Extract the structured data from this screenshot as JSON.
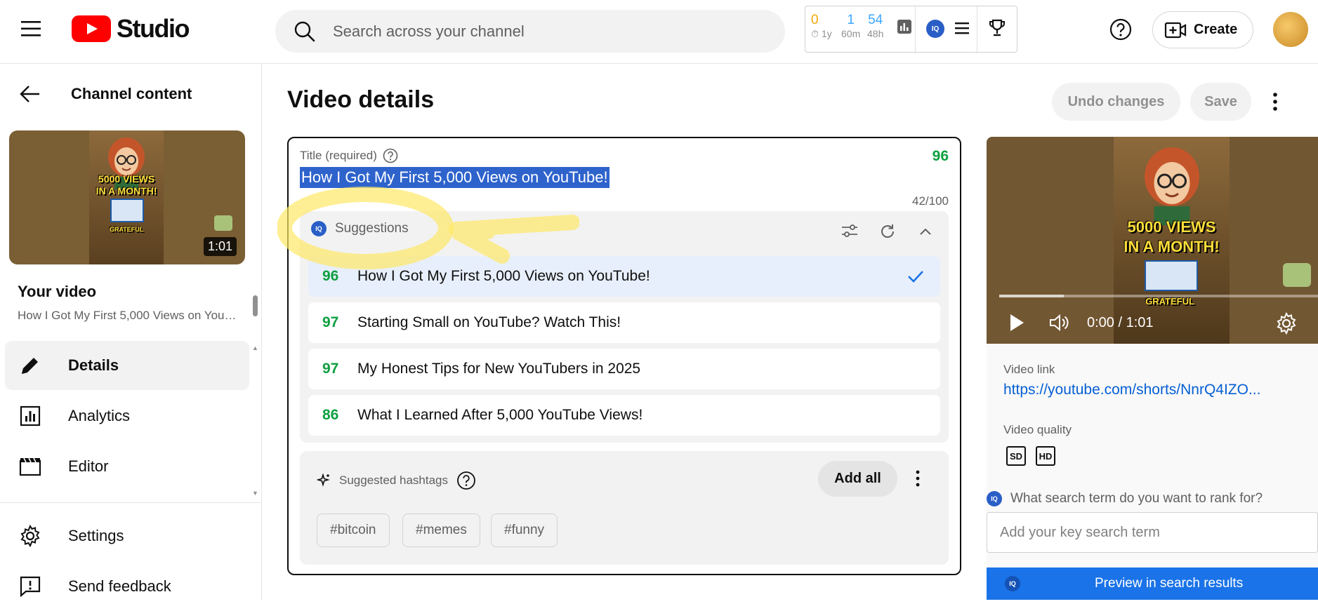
{
  "header": {
    "logo_text": "Studio",
    "search_placeholder": "Search across your channel",
    "vidiq_stats": [
      {
        "value": "0",
        "sub": "1y",
        "color": "#f6a609"
      },
      {
        "value": "1",
        "sub": "60m",
        "color": "#3ea6ff"
      },
      {
        "value": "54",
        "sub": "48h",
        "color": "#3ea6ff"
      }
    ],
    "vidiq_badge": "IQ",
    "create_label": "Create"
  },
  "sidebar": {
    "title": "Channel content",
    "thumbnail": {
      "duration": "1:01",
      "poster_line1": "5000 VIEWS",
      "poster_line2": "IN A MONTH!",
      "poster_bottom": "GRATEFUL"
    },
    "your_video_label": "Your video",
    "your_video_title": "How I Got My First 5,000 Views on YouTube!",
    "nav": [
      {
        "label": "Details",
        "icon": "pencil-icon",
        "active": true
      },
      {
        "label": "Analytics",
        "icon": "analytics-icon",
        "active": false
      },
      {
        "label": "Editor",
        "icon": "clapperboard-icon",
        "active": false
      },
      {
        "label": "Settings",
        "icon": "gear-icon",
        "active": false
      },
      {
        "label": "Send feedback",
        "icon": "feedback-icon",
        "active": false
      }
    ]
  },
  "main": {
    "page_title": "Video details",
    "undo_label": "Undo changes",
    "save_label": "Save",
    "title_field": {
      "label": "Title (required)",
      "score": "96",
      "value": "How I Got My First 5,000 Views on YouTube!",
      "count": "42/100"
    },
    "suggestions": {
      "label": "Suggestions",
      "badge": "IQ",
      "items": [
        {
          "score": "96",
          "text": "How I Got My First 5,000 Views on YouTube!",
          "selected": true
        },
        {
          "score": "97",
          "text": "Starting Small on YouTube? Watch This!",
          "selected": false
        },
        {
          "score": "97",
          "text": "My Honest Tips for New YouTubers in 2025",
          "selected": false
        },
        {
          "score": "86",
          "text": "What I Learned After 5,000 YouTube Views!",
          "selected": false
        }
      ]
    },
    "hashtags": {
      "label": "Suggested hashtags",
      "add_all_label": "Add all",
      "chips": [
        "#bitcoin",
        "#memes",
        "#funny"
      ]
    }
  },
  "right": {
    "player": {
      "time": "0:00 / 1:01",
      "progress": 0.2,
      "poster_line1": "5000 VIEWS",
      "poster_line2": "IN A MONTH!",
      "poster_bottom": "GRATEFUL"
    },
    "video_link_label": "Video link",
    "video_link": "https://youtube.com/shorts/NnrQ4IZO...",
    "video_quality_label": "Video quality",
    "quality_badges": [
      "SD",
      "HD"
    ],
    "keyword_prompt": "What search term do you want to rank for?",
    "keyword_placeholder": "Add your key search term",
    "preview_button": "Preview in search results",
    "badge": "IQ"
  },
  "colors": {
    "score_green": "#0e9f40",
    "selection_blue": "#2e63cc",
    "link_blue": "#065fd4",
    "brand_red": "#ff0000",
    "vidiq_blue": "#2a5ec7",
    "highlight_yellow": "#ffe866"
  }
}
